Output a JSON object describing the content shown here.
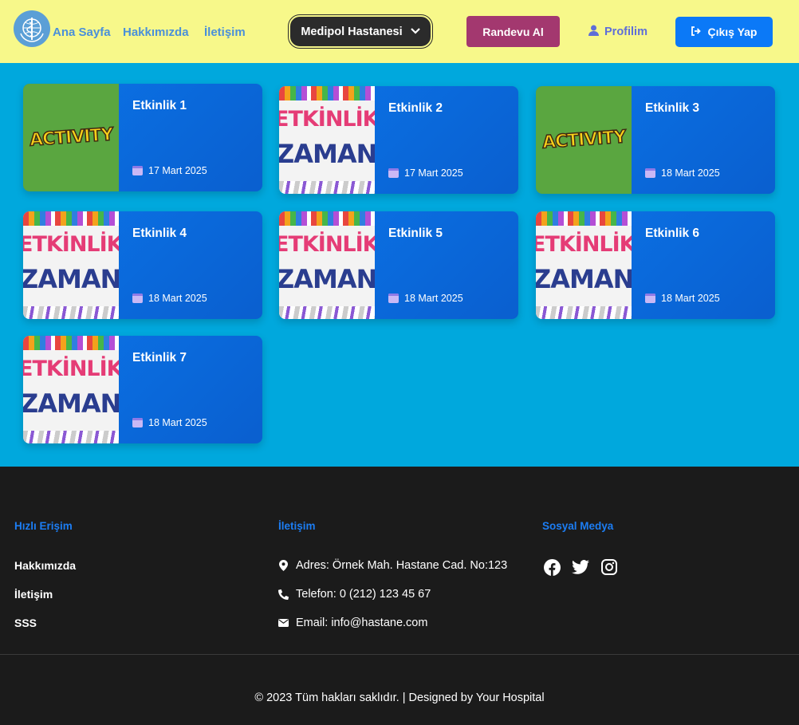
{
  "header": {
    "nav": [
      "Ana Sayfa",
      "Hakkımızda",
      "İletişim"
    ],
    "hospital_select": "Medipol Hastanesi",
    "randevu_label": "Randevu Al",
    "profile_label": "Profilim",
    "logout_label": "Çıkış Yap"
  },
  "events": [
    {
      "title": "Etkinlik 1",
      "date": "17 Mart 2025",
      "image": "activity"
    },
    {
      "title": "Etkinlik 2",
      "date": "17 Mart 2025",
      "image": "etkinlik-zamani"
    },
    {
      "title": "Etkinlik 3",
      "date": "18 Mart 2025",
      "image": "activity"
    },
    {
      "title": "Etkinlik 4",
      "date": "18 Mart 2025",
      "image": "etkinlik-zamani"
    },
    {
      "title": "Etkinlik 5",
      "date": "18 Mart 2025",
      "image": "etkinlik-zamani"
    },
    {
      "title": "Etkinlik 6",
      "date": "18 Mart 2025",
      "image": "etkinlik-zamani"
    },
    {
      "title": "Etkinlik 7",
      "date": "18 Mart 2025",
      "image": "etkinlik-zamani"
    }
  ],
  "event_images": {
    "activity_text": "ACTIVITY",
    "zaman_line1": "ETKİNLİK",
    "zaman_line2": "ZAMANI"
  },
  "footer": {
    "quick_access_heading": "Hızlı Erişim",
    "quick_links": [
      "Hakkımızda",
      "İletişim",
      "SSS"
    ],
    "contact_heading": "İletişim",
    "address": "Adres: Örnek Mah. Hastane Cad. No:123",
    "phone": "Telefon: 0 (212) 123 45 67",
    "email": "Email: info@hastane.com",
    "social_heading": "Sosyal Medya",
    "social_icons": [
      "facebook-icon",
      "twitter-icon",
      "instagram-icon"
    ],
    "copyright": "© 2023 Tüm hakları saklıdır. | Designed by Your Hospital"
  },
  "colors": {
    "header_bg": "#f7f88a",
    "main_bg": "#00a8dd",
    "card_bg": "#0b74e8",
    "footer_bg": "#1b1b1b",
    "randevu_bg": "#a3386f",
    "logout_bg": "#0b79f7",
    "link_blue": "#4a90d9"
  }
}
